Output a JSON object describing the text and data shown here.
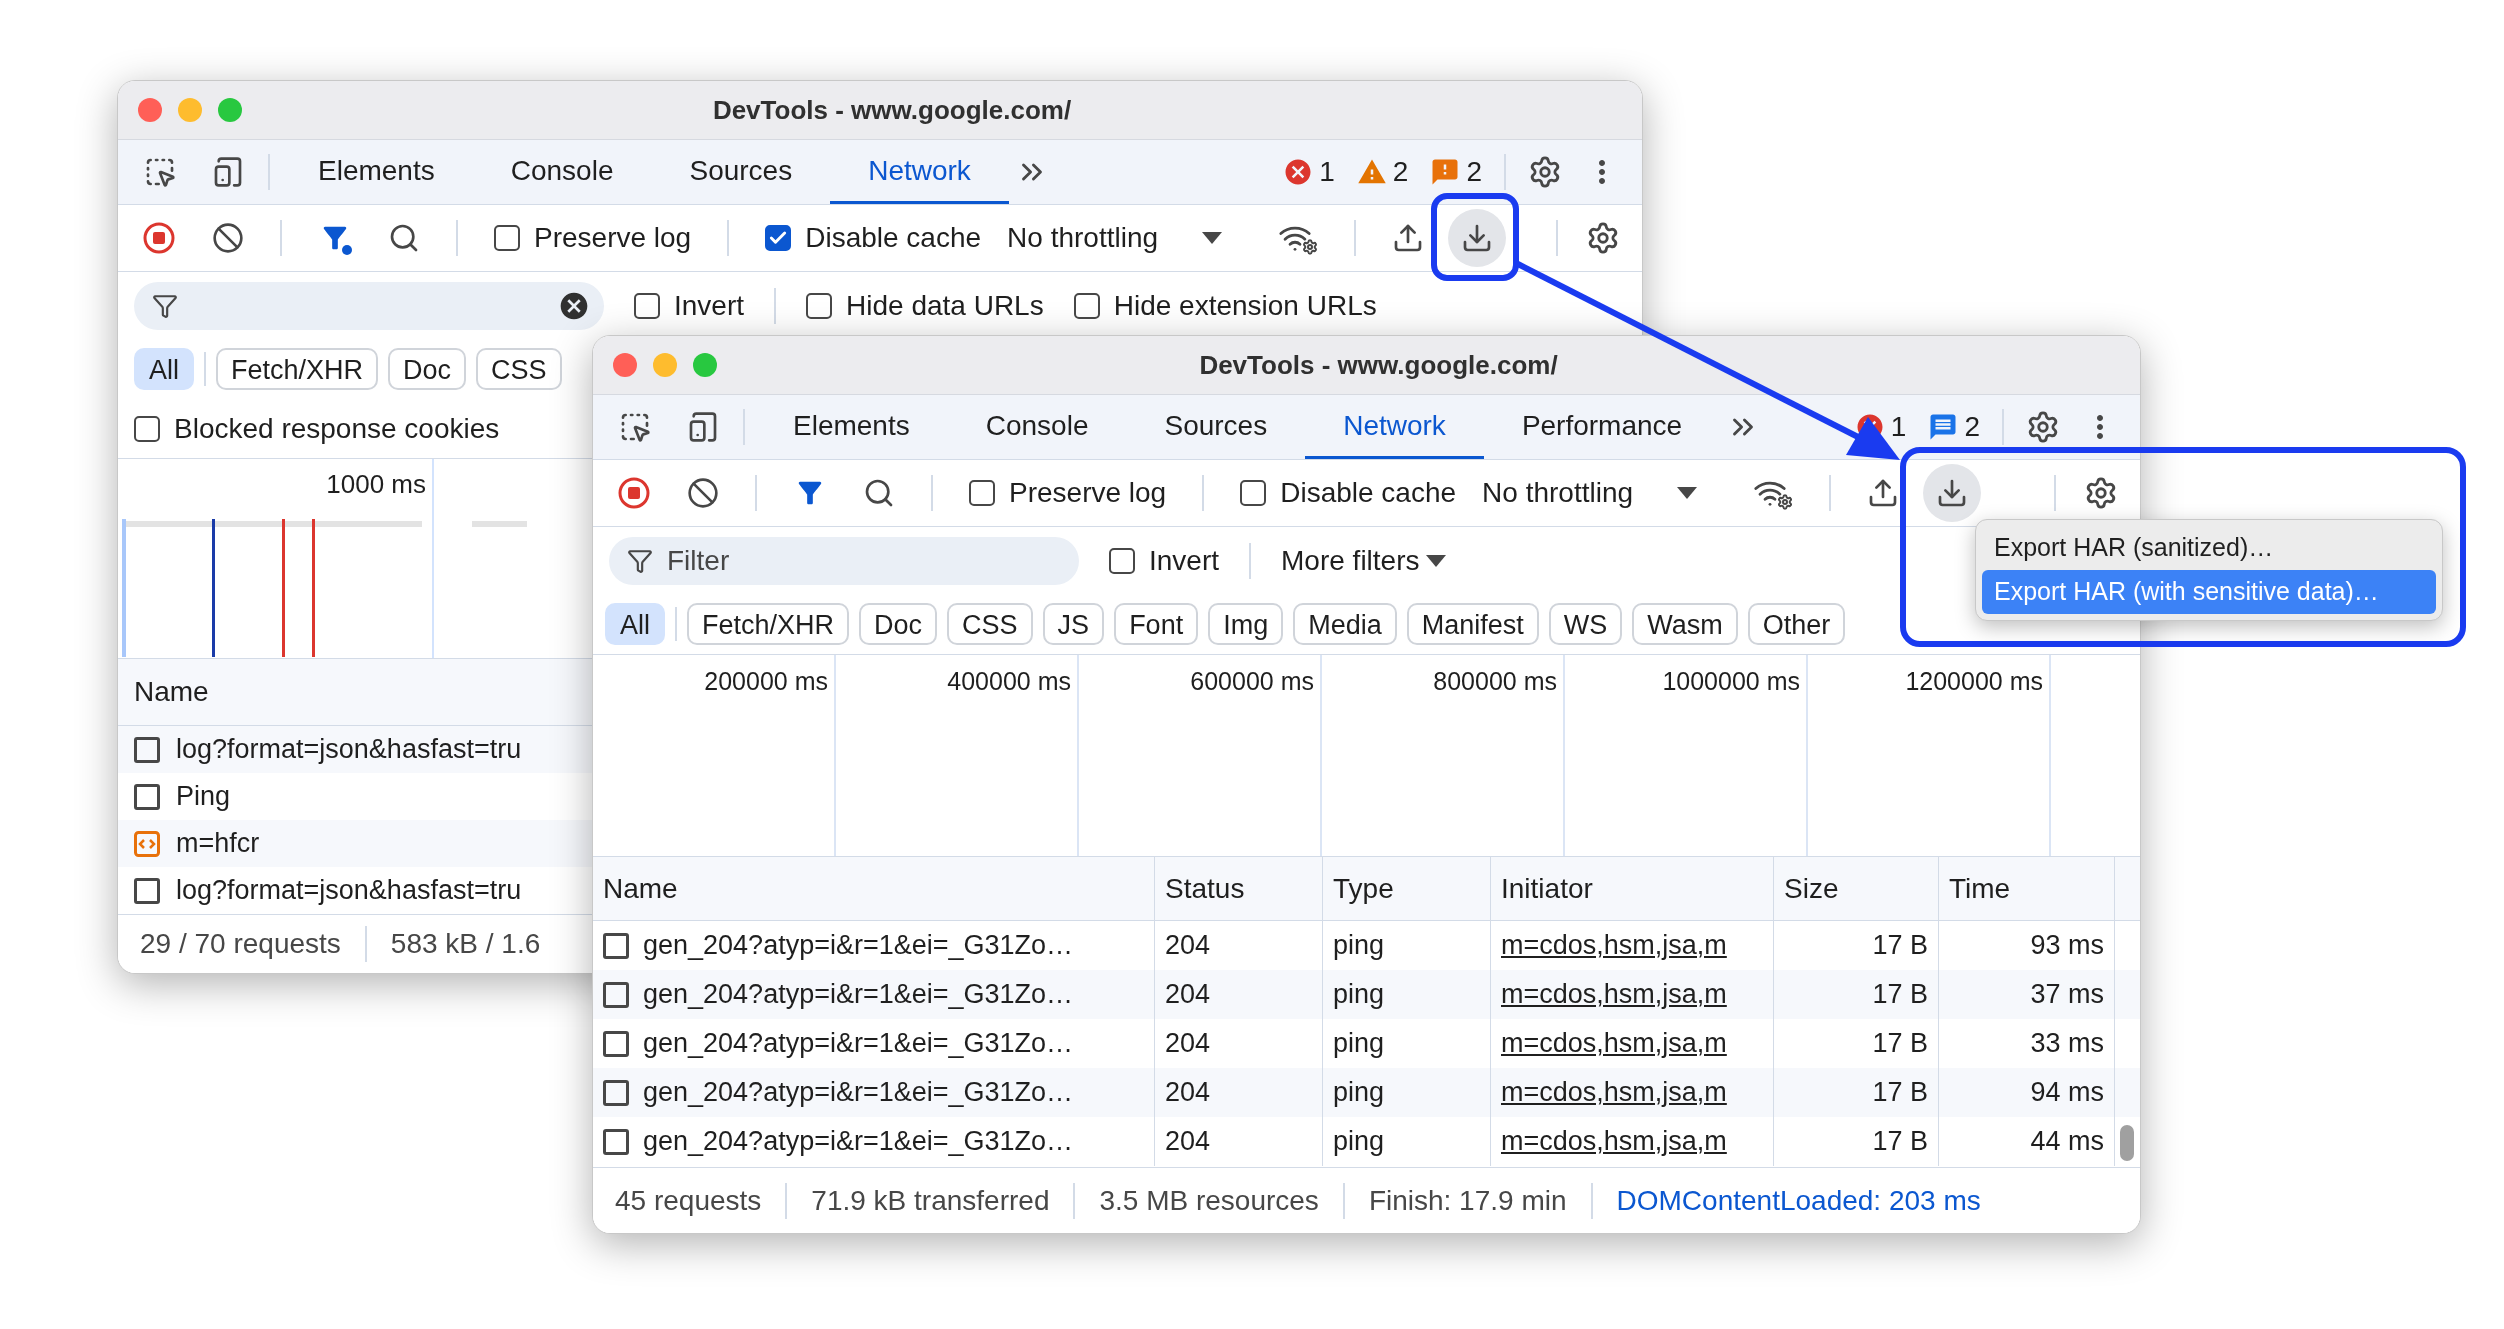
{
  "back_window": {
    "title": "DevTools - www.google.com/",
    "tabs": [
      {
        "label": "Elements",
        "selected": false
      },
      {
        "label": "Console",
        "selected": false
      },
      {
        "label": "Sources",
        "selected": false
      },
      {
        "label": "Network",
        "selected": true
      }
    ],
    "counters": [
      {
        "kind": "error",
        "count": "1"
      },
      {
        "kind": "warning",
        "count": "2"
      },
      {
        "kind": "issue",
        "count": "2"
      }
    ],
    "toolbar": {
      "filter_active": true,
      "checkboxes": [
        {
          "label": "Preserve log",
          "checked": false
        },
        {
          "label": "Disable cache",
          "checked": true
        }
      ],
      "throttling": "No throttling"
    },
    "filter_bar": {
      "clear_button": true,
      "checkboxes": [
        {
          "label": "Invert",
          "checked": false
        },
        {
          "label": "Hide data URLs",
          "checked": false
        },
        {
          "label": "Hide extension URLs",
          "checked": false
        }
      ]
    },
    "chips": [
      {
        "label": "All",
        "selected": true
      },
      {
        "label": "Fetch/XHR",
        "selected": false
      },
      {
        "label": "Doc",
        "selected": false
      },
      {
        "label": "CSS",
        "selected": false
      }
    ],
    "options": [
      {
        "label": "Blocked response cookies",
        "checked": false
      }
    ],
    "timeline": {
      "labels": [
        "1000 ms"
      ]
    },
    "table": {
      "columns": [
        "Name"
      ],
      "rows": [
        {
          "kind": "other",
          "name": "log?format=json&hasfast=tru"
        },
        {
          "kind": "other",
          "name": "Ping"
        },
        {
          "kind": "script",
          "name": "m=hfcr"
        },
        {
          "kind": "other",
          "name": "log?format=json&hasfast=tru"
        }
      ]
    },
    "status": [
      {
        "kind": "plain",
        "text": "29 / 70 requests"
      },
      {
        "kind": "plain",
        "text": "583 kB / 1.6"
      }
    ]
  },
  "front_window": {
    "title": "DevTools - www.google.com/",
    "tabs": [
      {
        "label": "Elements",
        "selected": false
      },
      {
        "label": "Console",
        "selected": false
      },
      {
        "label": "Sources",
        "selected": false
      },
      {
        "label": "Network",
        "selected": true
      },
      {
        "label": "Performance",
        "selected": false
      }
    ],
    "counters": [
      {
        "kind": "error",
        "count": "1"
      },
      {
        "kind": "message",
        "count": "2"
      }
    ],
    "toolbar": {
      "filter_active": false,
      "checkboxes": [
        {
          "label": "Preserve log",
          "checked": false
        },
        {
          "label": "Disable cache",
          "checked": false
        }
      ],
      "throttling": "No throttling"
    },
    "filter_bar": {
      "placeholder": "Filter",
      "clear_button": false,
      "checkboxes": [
        {
          "label": "Invert",
          "checked": false
        }
      ],
      "more_filters": "More filters"
    },
    "chips": [
      {
        "label": "All",
        "selected": true
      },
      {
        "label": "Fetch/XHR",
        "selected": false
      },
      {
        "label": "Doc",
        "selected": false
      },
      {
        "label": "CSS",
        "selected": false
      },
      {
        "label": "JS",
        "selected": false
      },
      {
        "label": "Font",
        "selected": false
      },
      {
        "label": "Img",
        "selected": false
      },
      {
        "label": "Media",
        "selected": false
      },
      {
        "label": "Manifest",
        "selected": false
      },
      {
        "label": "WS",
        "selected": false
      },
      {
        "label": "Wasm",
        "selected": false
      },
      {
        "label": "Other",
        "selected": false
      }
    ],
    "timeline": {
      "labels": [
        "200000 ms",
        "400000 ms",
        "600000 ms",
        "800000 ms",
        "1000000 ms",
        "1200000 ms"
      ]
    },
    "table": {
      "columns": [
        "Name",
        "Status",
        "Type",
        "Initiator",
        "Size",
        "Time"
      ],
      "rows": [
        {
          "kind": "other",
          "name": "gen_204?atyp=i&r=1&ei=_G31Zo…",
          "status": "204",
          "type": "ping",
          "initiator": "m=cdos,hsm,jsa,m",
          "size": "17 B",
          "time": "93 ms"
        },
        {
          "kind": "other",
          "name": "gen_204?atyp=i&r=1&ei=_G31Zo…",
          "status": "204",
          "type": "ping",
          "initiator": "m=cdos,hsm,jsa,m",
          "size": "17 B",
          "time": "37 ms"
        },
        {
          "kind": "other",
          "name": "gen_204?atyp=i&r=1&ei=_G31Zo…",
          "status": "204",
          "type": "ping",
          "initiator": "m=cdos,hsm,jsa,m",
          "size": "17 B",
          "time": "33 ms"
        },
        {
          "kind": "other",
          "name": "gen_204?atyp=i&r=1&ei=_G31Zo…",
          "status": "204",
          "type": "ping",
          "initiator": "m=cdos,hsm,jsa,m",
          "size": "17 B",
          "time": "94 ms"
        },
        {
          "kind": "other",
          "name": "gen_204?atyp=i&r=1&ei=_G31Zo…",
          "status": "204",
          "type": "ping",
          "initiator": "m=cdos,hsm,jsa,m",
          "size": "17 B",
          "time": "44 ms"
        }
      ]
    },
    "status": [
      {
        "kind": "plain",
        "text": "45 requests"
      },
      {
        "kind": "plain",
        "text": "71.9 kB transferred"
      },
      {
        "kind": "plain",
        "text": "3.5 MB resources"
      },
      {
        "kind": "plain",
        "text": "Finish: 17.9 min"
      },
      {
        "kind": "highlight",
        "text": "DOMContentLoaded: 203 ms"
      }
    ]
  },
  "export_menu": {
    "items": [
      {
        "label": "Export HAR (sanitized)…",
        "selected": false
      },
      {
        "label": "Export HAR (with sensitive data)…",
        "selected": true
      }
    ]
  }
}
